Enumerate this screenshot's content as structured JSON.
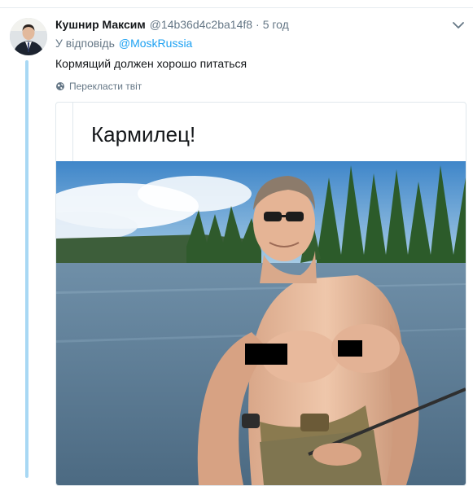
{
  "tweet": {
    "display_name": "Кушнир Максим",
    "handle": "@14b36d4c2ba14f8",
    "separator": "·",
    "time": "5 год",
    "reply_prefix": "У відповідь",
    "reply_mention": "@MoskRussia",
    "text": "Кормящий должен хорошо питаться",
    "translate_label": "Перекласти твіт",
    "translate_icon": "globe-icon",
    "more_icon": "chevron-down-icon"
  },
  "quote": {
    "text": "Кармилец!"
  },
  "colors": {
    "link": "#1da1f2",
    "secondary_text": "#657786",
    "thread_line": "#a8d8f4",
    "border": "#e1e8ed"
  }
}
